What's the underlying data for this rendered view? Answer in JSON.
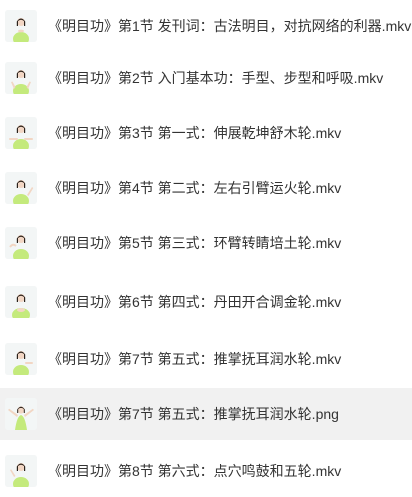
{
  "files": [
    {
      "name": "《明目功》第1节 发刊词：古法明目，对抗网络的利器.mkv",
      "thumbnail": "instructor-thumbnail",
      "selected": false
    },
    {
      "name": "《明目功》第2节 入门基本功：手型、步型和呼吸.mkv",
      "thumbnail": "instructor-thumbnail",
      "selected": false
    },
    {
      "name": "《明目功》第3节 第一式：伸展乾坤舒木轮.mkv",
      "thumbnail": "instructor-thumbnail",
      "selected": false
    },
    {
      "name": "《明目功》第4节 第二式：左右引臂运火轮.mkv",
      "thumbnail": "instructor-thumbnail",
      "selected": false
    },
    {
      "name": "《明目功》第5节 第三式：环臂转睛培土轮.mkv",
      "thumbnail": "instructor-thumbnail",
      "selected": false
    },
    {
      "name": "《明目功》第6节 第四式：丹田开合调金轮.mkv",
      "thumbnail": "instructor-thumbnail",
      "selected": false
    },
    {
      "name": "《明目功》第7节 第五式：推掌抚耳润水轮.mkv",
      "thumbnail": "instructor-thumbnail",
      "selected": false
    },
    {
      "name": "《明目功》第7节 第五式：推掌抚耳润水轮.png",
      "thumbnail": "instructor-thumbnail",
      "selected": true
    },
    {
      "name": "《明目功》第8节 第六式：点穴鸣鼓和五轮.mkv",
      "thumbnail": "instructor-thumbnail",
      "selected": false
    }
  ],
  "colors": {
    "text": "#333333",
    "selected_row": "#f1f1f1",
    "shirt": "#c4ea7c",
    "hair": "#2a221c",
    "skin": "#f2d6c4"
  }
}
